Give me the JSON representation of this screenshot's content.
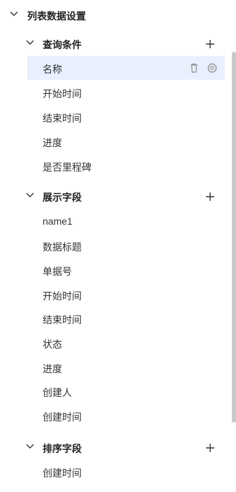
{
  "root": {
    "title": "列表数据设置"
  },
  "sections": [
    {
      "title": "查询条件",
      "items": [
        "名称",
        "开始时间",
        "结束时间",
        "进度",
        "是否里程碑"
      ]
    },
    {
      "title": "展示字段",
      "items": [
        "name1",
        "数据标题",
        "单据号",
        "开始时间",
        "结束时间",
        "状态",
        "进度",
        "创建人",
        "创建时间"
      ]
    },
    {
      "title": "排序字段",
      "items": [
        "创建时间"
      ]
    }
  ],
  "selected_item": "名称",
  "icons": {
    "expand": "chevron-down-icon",
    "add": "plus-icon",
    "delete": "trash-icon",
    "settings": "gear-icon"
  },
  "colors": {
    "selected_bg": "#e8f0fe",
    "icon": "#8c8c8c"
  }
}
